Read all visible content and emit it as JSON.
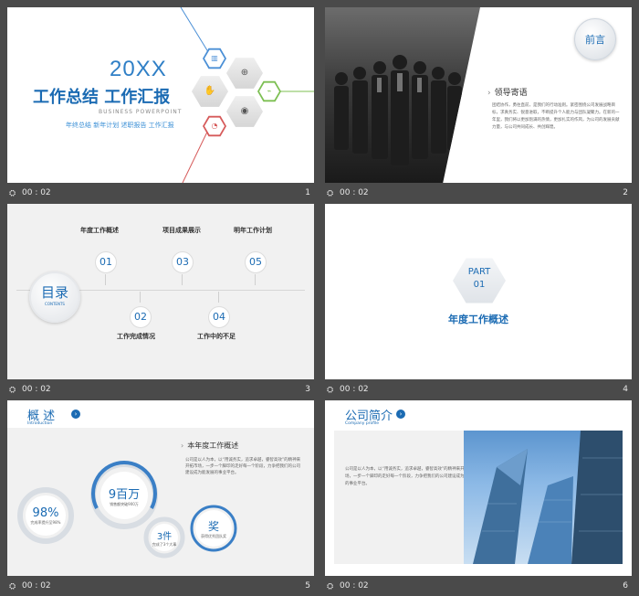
{
  "slides": [
    {
      "time": "00 : 02",
      "number": "1",
      "year": "20XX",
      "title": "工作总结 工作汇报",
      "subtitle": "BUSINESS POWERPOINT",
      "tags": "年终总结  新年计划  述职报告  工作汇报",
      "icons": [
        "bar-chart-icon",
        "search-chart-icon",
        "handshake-icon",
        "target-icon",
        "line-chart-icon",
        "pie-chart-icon"
      ]
    },
    {
      "time": "00 : 02",
      "number": "2",
      "badge": "前言",
      "heading": "领导寄语",
      "body": "团结协作，勇往直前，是我们的行动准则。紧密围绕公司发展战略目标，求真务实、锐意进取，不断提升个人能力与团队凝聚力。在新的一年里，我们将以更加饱满的热情，更加扎实的作风，为公司的发展贡献力量，与公司共同成长、共创辉煌。"
    },
    {
      "time": "00 : 02",
      "number": "3",
      "menu_title": "目录",
      "menu_en": "CONTENTS",
      "items": [
        {
          "num": "01",
          "label": "年度工作概述"
        },
        {
          "num": "02",
          "label": "工作完成情况"
        },
        {
          "num": "03",
          "label": "项目成果展示"
        },
        {
          "num": "04",
          "label": "工作中的不足"
        },
        {
          "num": "05",
          "label": "明年工作计划"
        }
      ]
    },
    {
      "time": "00 : 02",
      "number": "4",
      "part": "PART",
      "part_num": "01",
      "title": "年度工作概述"
    },
    {
      "time": "00 : 02",
      "number": "5",
      "heading": "概 述",
      "heading_en": "Introduction",
      "subheading": "本年度工作概述",
      "body": "公司是以人为本，以“用诚务实，追求卓越，睿智高效”的精神来开拓市场，一步一个脚印的走好每一个阶段，力争把我们的公司建设成为能发展的事业平台。",
      "stats": [
        {
          "value": "98%",
          "desc": "完成率提升至98%"
        },
        {
          "value": "9百万",
          "desc": "销售额突破900万"
        },
        {
          "value": "3件",
          "desc": "完成了3个大事"
        },
        {
          "value": "奖",
          "desc": "获得优秀团队奖"
        }
      ]
    },
    {
      "time": "00 : 02",
      "number": "6",
      "heading": "公司简介",
      "heading_en": "Company profile",
      "body": "公司是以人为本，以“用诚务实，追求卓越，睿智高效”的精神来开拓市场，一步一个脚印的走好每一个阶段，力争把我们的公司建设成为能发展的事业平台。"
    }
  ],
  "colors": {
    "accent": "#1b6bb3",
    "background": "#4a4a4a",
    "panel": "#f1f1f1"
  }
}
